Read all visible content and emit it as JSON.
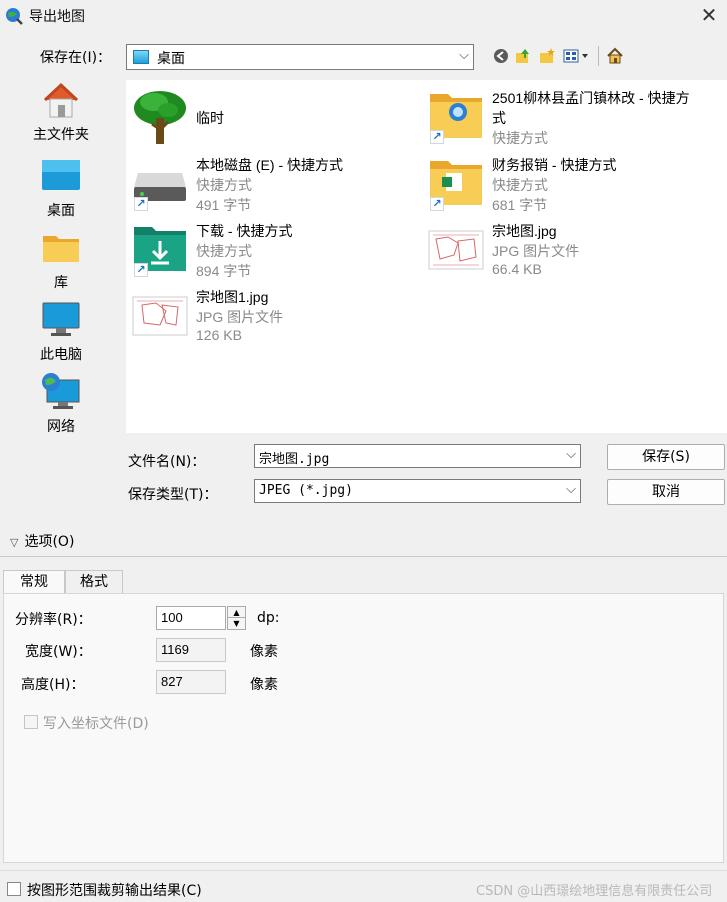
{
  "window": {
    "title": "导出地图"
  },
  "toolbar": {
    "save_in_label": "保存在(I)：",
    "save_in_value": "桌面",
    "back_icon": "back-arrow-icon",
    "up_icon": "up-folder-icon",
    "new_folder_icon": "new-folder-icon",
    "view_menu_icon": "view-menu-icon",
    "home_icon": "home-icon"
  },
  "places": [
    {
      "label": "主文件夹",
      "icon": "home-icon"
    },
    {
      "label": "桌面",
      "icon": "desktop-icon"
    },
    {
      "label": "库",
      "icon": "library-folder-icon"
    },
    {
      "label": "此电脑",
      "icon": "computer-icon"
    },
    {
      "label": "网络",
      "icon": "network-icon"
    }
  ],
  "files": [
    {
      "name": "临时",
      "type": "",
      "size": "",
      "icon": "tree-folder-icon"
    },
    {
      "name": "2501柳林县孟门镇林改 - 快捷方",
      "name2": "式",
      "type": "快捷方式",
      "size": "",
      "icon": "folder-shortcut-icon"
    },
    {
      "name": "本地磁盘 (E) - 快捷方式",
      "type": "快捷方式",
      "size": "491 字节",
      "icon": "disk-drive-icon"
    },
    {
      "name": "财务报销 - 快捷方式",
      "type": "快捷方式",
      "size": "681 字节",
      "icon": "folder-excel-icon"
    },
    {
      "name": "下载 - 快捷方式",
      "type": "快捷方式",
      "size": "894 字节",
      "icon": "download-folder-icon"
    },
    {
      "name": "宗地图.jpg",
      "type": "JPG 图片文件",
      "size": "66.4 KB",
      "icon": "map-image-icon"
    },
    {
      "name": "宗地图1.jpg",
      "type": "JPG 图片文件",
      "size": "126 KB",
      "icon": "map-image-icon"
    }
  ],
  "file_name": {
    "label": "文件名(N)：",
    "value": "宗地图.jpg"
  },
  "file_type": {
    "label": "保存类型(T)：",
    "value": "JPEG (*.jpg)"
  },
  "buttons": {
    "save": "保存(S)",
    "cancel": "取消"
  },
  "options": {
    "toggle_label": "选项(O)",
    "tabs": [
      "常规",
      "格式"
    ],
    "resolution_label": "分辨率(R)：",
    "resolution_value": "100",
    "resolution_unit": "dp:",
    "width_label": "宽度(W)：",
    "width_value": "1169",
    "width_unit": "像素",
    "height_label": "高度(H)：",
    "height_value": "827",
    "height_unit": "像素",
    "world_file_label": "写入坐标文件(D)",
    "clip_label": "按图形范围裁剪输出结果(C)"
  },
  "watermark": "CSDN @山西璟绘地理信息有限责任公司"
}
